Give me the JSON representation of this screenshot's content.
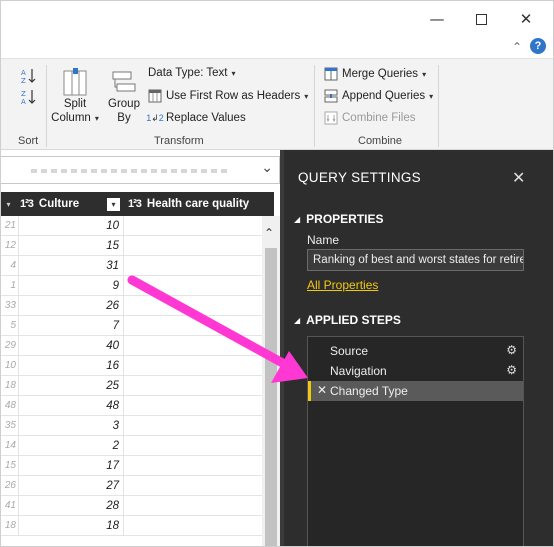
{
  "window": {
    "minimize_icon": "minimize-icon",
    "maximize_icon": "maximize-icon",
    "close_icon": "close-icon"
  },
  "ribbon": {
    "sort_label": "Sort",
    "split_column": [
      "Split",
      "Column"
    ],
    "group_by": [
      "Group",
      "By"
    ],
    "data_type_label": "Data Type: Text",
    "use_first_row": "Use First Row as Headers",
    "replace_values": "Replace Values",
    "transform_label": "Transform",
    "merge_queries": "Merge Queries",
    "append_queries": "Append Queries",
    "combine_files": "Combine Files",
    "combine_label": "Combine"
  },
  "grid": {
    "columns": [
      {
        "type_icon": "1²3",
        "name": "Culture"
      },
      {
        "type_icon": "1²3",
        "name": "Health care quality"
      }
    ],
    "row_index_fragments": [
      "21",
      "12",
      "4",
      "1",
      "33",
      "5",
      "29",
      "10",
      "18",
      "48",
      "35",
      "14",
      "15",
      "26",
      "41",
      "18"
    ],
    "culture_values": [
      "10",
      "15",
      "31",
      "9",
      "26",
      "7",
      "40",
      "16",
      "25",
      "48",
      "3",
      "2",
      "17",
      "27",
      "28",
      "18"
    ]
  },
  "query_settings": {
    "title": "QUERY SETTINGS",
    "properties_header": "PROPERTIES",
    "name_label": "Name",
    "name_value": "Ranking of best and worst states for retire",
    "all_properties": "All Properties",
    "applied_steps_header": "APPLIED STEPS",
    "steps": [
      {
        "label": "Source",
        "has_gear": true,
        "active": false
      },
      {
        "label": "Navigation",
        "has_gear": true,
        "active": false
      },
      {
        "label": "Changed Type",
        "has_gear": false,
        "active": true
      }
    ]
  },
  "colors": {
    "accent_yellow": "#f2c811",
    "arrow_magenta": "#ff38d4",
    "pane_bg": "#2d2d2d"
  }
}
